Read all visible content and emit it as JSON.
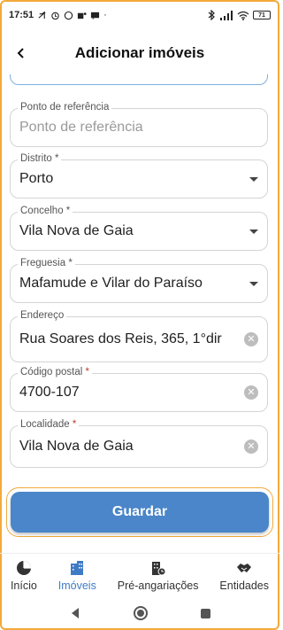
{
  "status_bar": {
    "time": "17:51",
    "battery": "71"
  },
  "app_bar": {
    "title": "Adicionar imóveis"
  },
  "form": {
    "reference": {
      "label": "Ponto de referência",
      "placeholder": "Ponto de referência"
    },
    "district": {
      "label": "Distrito",
      "required_mark": "*",
      "value": "Porto"
    },
    "municipality": {
      "label": "Concelho",
      "required_mark": "*",
      "value": "Vila Nova de Gaia"
    },
    "parish": {
      "label": "Freguesia",
      "required_mark": "*",
      "value": "Mafamude e Vilar do Paraíso"
    },
    "address": {
      "label": "Endereço",
      "value": "Rua Soares dos Reis, 365, 1°dir"
    },
    "postal_code": {
      "label": "Código postal",
      "required_mark": "*",
      "value": "4700-107"
    },
    "locality": {
      "label": "Localidade",
      "required_mark": "*",
      "value": "Vila Nova de Gaia"
    }
  },
  "actions": {
    "save_label": "Guardar"
  },
  "bottom_nav": {
    "items": [
      {
        "label": "Início",
        "icon": "pie-chart-icon"
      },
      {
        "label": "Imóveis",
        "icon": "buildings-icon",
        "active": true
      },
      {
        "label": "Pré-angariações",
        "icon": "building-clock-icon"
      },
      {
        "label": "Entidades",
        "icon": "handshake-icon"
      }
    ]
  },
  "colors": {
    "accent": "#4a86c9",
    "active_nav": "#3f7bc4",
    "required": "#c0392b"
  }
}
